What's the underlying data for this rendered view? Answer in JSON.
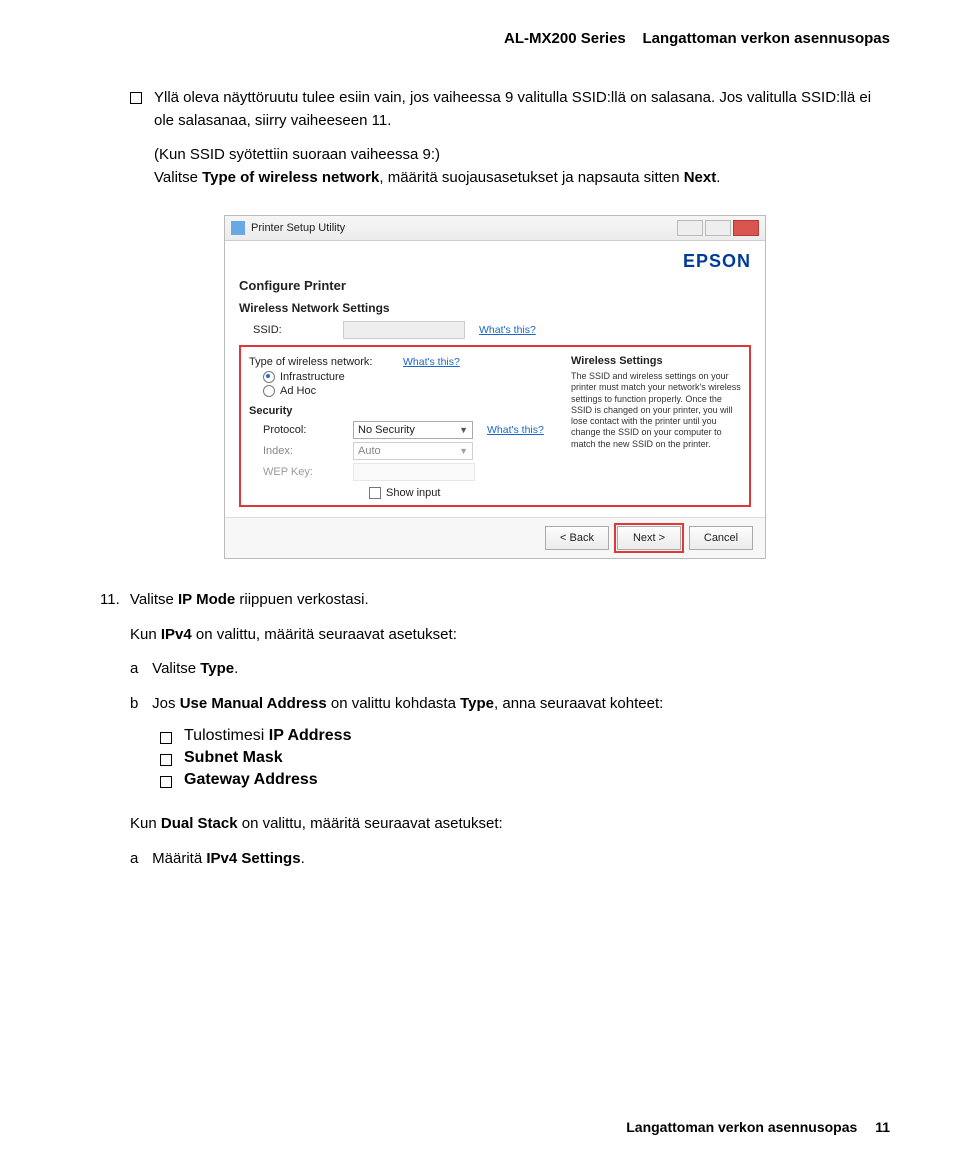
{
  "header": {
    "series": "AL-MX200 Series",
    "guide_title": "Langattoman verkon asennusopas"
  },
  "body": {
    "para1_a": "Yllä oleva näyttöruutu tulee esiin vain, jos vaiheessa 9 valitulla SSID:llä on salasana. Jos valitulla SSID:llä ei ole salasanaa, siirry vaiheeseen 11.",
    "para2_a": "(Kun SSID syötettiin suoraan vaiheessa 9:)",
    "para2_b": "Valitse ",
    "para2_bold1": "Type of wireless network",
    "para2_c": ", määritä suojausasetukset ja napsauta sitten ",
    "para2_bold2": "Next",
    "para2_d": ".",
    "step11_num": "11.",
    "step11_a": "Valitse ",
    "step11_bold": "IP Mode",
    "step11_b": " riippuen verkostasi.",
    "para3_a": "Kun ",
    "para3_bold": "IPv4",
    "para3_b": " on valittu, määritä seuraavat asetukset:",
    "sub_a_letter": "a",
    "sub_a_a": "Valitse ",
    "sub_a_bold": "Type",
    "sub_a_b": ".",
    "sub_b_letter": "b",
    "sub_b_a": "Jos ",
    "sub_b_bold1": "Use Manual Address",
    "sub_b_b": " on valittu kohdasta ",
    "sub_b_bold2": "Type",
    "sub_b_c": ", anna seuraavat kohteet:",
    "bullets": {
      "b1_a": "Tulostimesi ",
      "b1_bold": "IP Address",
      "b2_bold": "Subnet Mask",
      "b3_bold": "Gateway Address"
    },
    "para4_a": "Kun ",
    "para4_bold": "Dual Stack",
    "para4_b": " on valittu, määritä seuraavat asetukset:",
    "sub_a2_letter": "a",
    "sub_a2_a": "Määritä ",
    "sub_a2_bold": "IPv4 Settings",
    "sub_a2_b": "."
  },
  "screenshot": {
    "window_title": "Printer Setup Utility",
    "logo": "EPSON",
    "configure": "Configure Printer",
    "wns": "Wireless Network Settings",
    "ssid_label": "SSID:",
    "whats": "What's this?",
    "type_label": "Type of wireless network:",
    "radio_infra": "Infrastructure",
    "radio_adhoc": "Ad Hoc",
    "security": "Security",
    "protocol_label": "Protocol:",
    "protocol_value": "No Security",
    "index_label": "Index:",
    "index_value": "Auto",
    "wepkey_label": "WEP Key:",
    "show_input": "Show input",
    "right_title": "Wireless Settings",
    "right_fine": "The SSID and wireless settings on your printer must match your network's wireless settings to function properly. Once the SSID is changed on your printer, you will lose contact with the printer until you change the SSID on your computer to match the new SSID on the printer.",
    "btn_back": "< Back",
    "btn_next": "Next >",
    "btn_cancel": "Cancel"
  },
  "footer": {
    "guide_title": "Langattoman verkon asennusopas",
    "page": "11"
  }
}
